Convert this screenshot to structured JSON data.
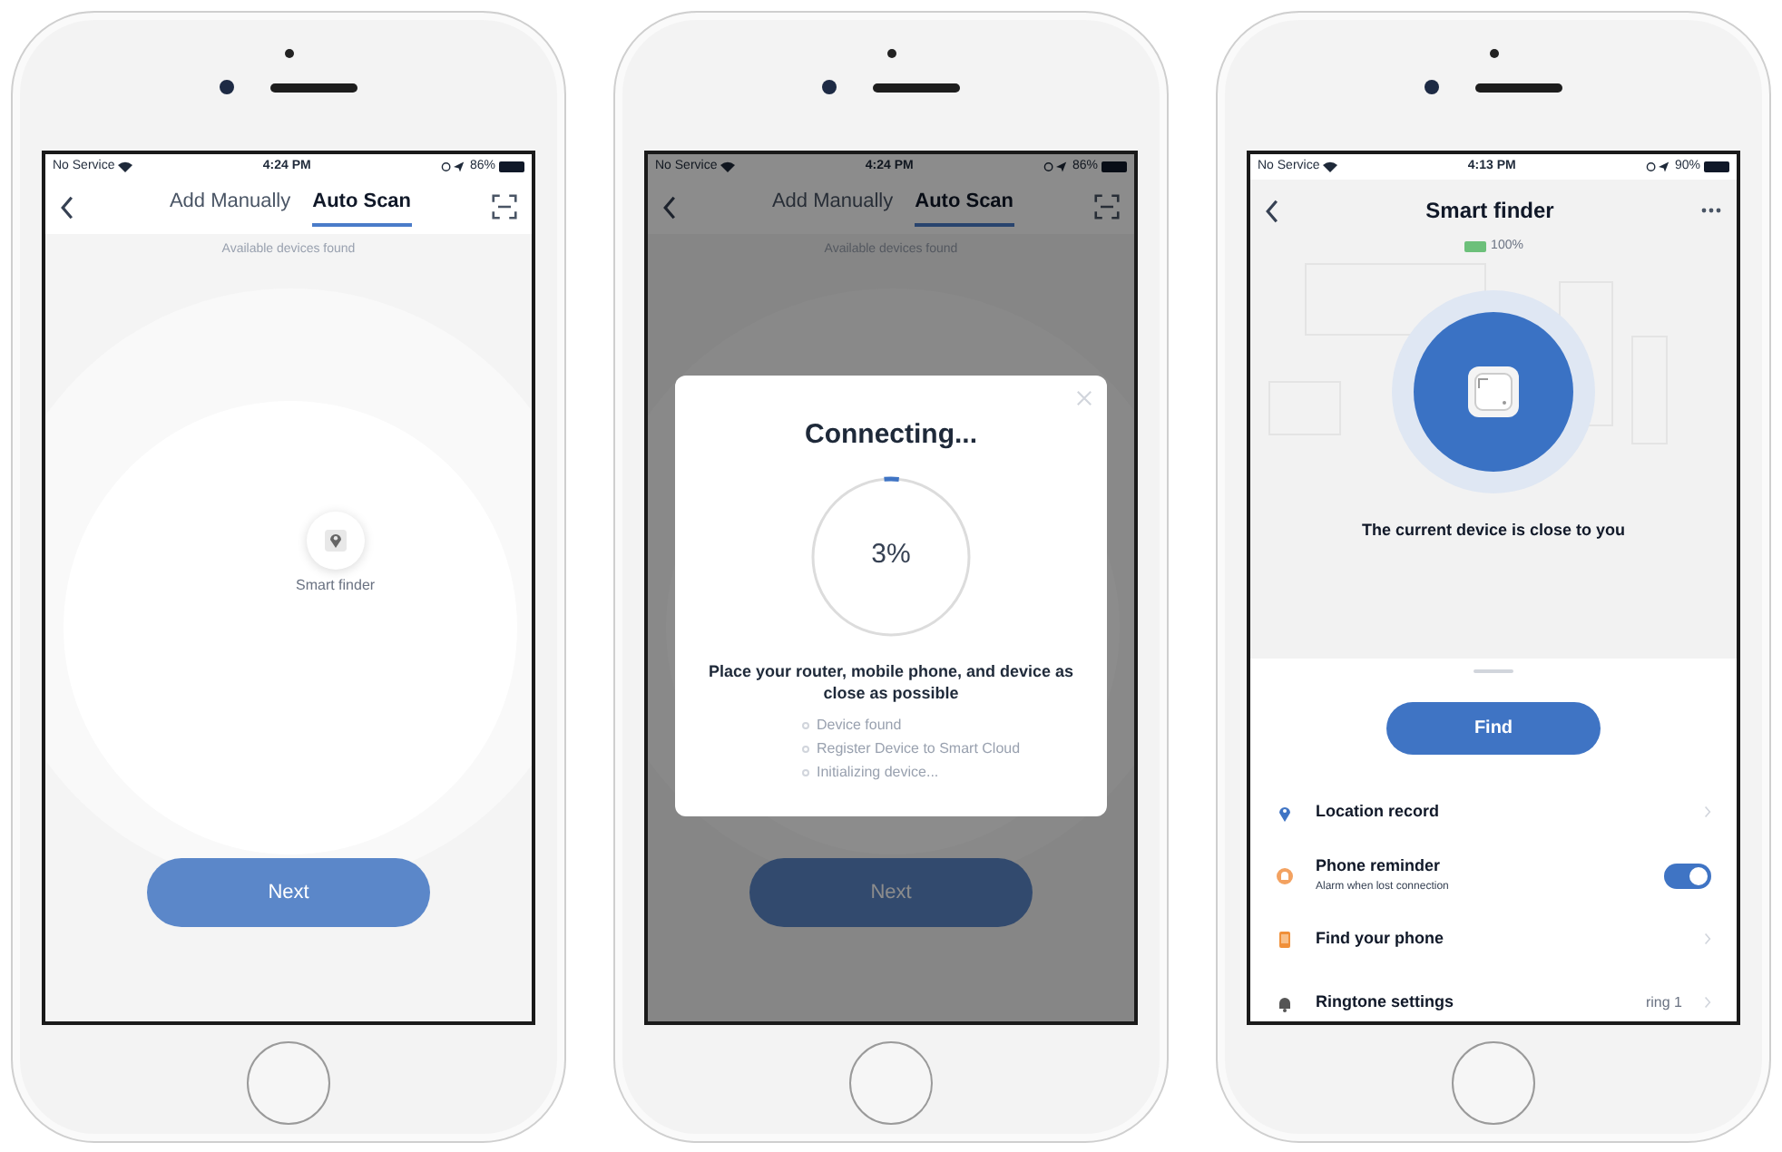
{
  "phones": [
    {
      "kind": "scan",
      "status_bar": {
        "carrier": "No Service",
        "time": "4:24 PM",
        "battery": "86%"
      },
      "tabs": [
        {
          "label": "Add Manually",
          "selected": false
        },
        {
          "label": "Auto Scan",
          "selected": true
        }
      ],
      "hint": "Available devices found",
      "device": {
        "label": "Smart finder"
      },
      "button": "Next"
    },
    {
      "kind": "connecting",
      "status_bar": {
        "carrier": "No Service",
        "time": "4:24 PM",
        "battery": "86%"
      },
      "tabs": [
        {
          "label": "Add Manually",
          "selected": false
        },
        {
          "label": "Auto Scan",
          "selected": true
        }
      ],
      "hint": "Available devices found",
      "button": "Next",
      "dialog": {
        "title": "Connecting...",
        "progress": {
          "level": 0.03,
          "reading": "3%"
        },
        "message": "Place your router, mobile phone, and device as close as possible",
        "steps": [
          "Device found",
          "Register Device to Smart Cloud",
          "Initializing device..."
        ]
      }
    },
    {
      "kind": "finder",
      "status_bar": {
        "carrier": "No Service",
        "time": "4:13 PM",
        "battery": "90%"
      },
      "title": "Smart finder",
      "device_battery": "100%",
      "status": "The current device is close to you",
      "button": "Find",
      "settings": [
        {
          "kind": "link",
          "label": "Location record"
        },
        {
          "kind": "toggle",
          "label": "Phone reminder",
          "subtitle": "Alarm when lost connection",
          "on": true
        },
        {
          "kind": "link",
          "label": "Find your phone"
        },
        {
          "kind": "link",
          "label": "Ringtone settings",
          "value": "ring 1"
        }
      ]
    }
  ]
}
